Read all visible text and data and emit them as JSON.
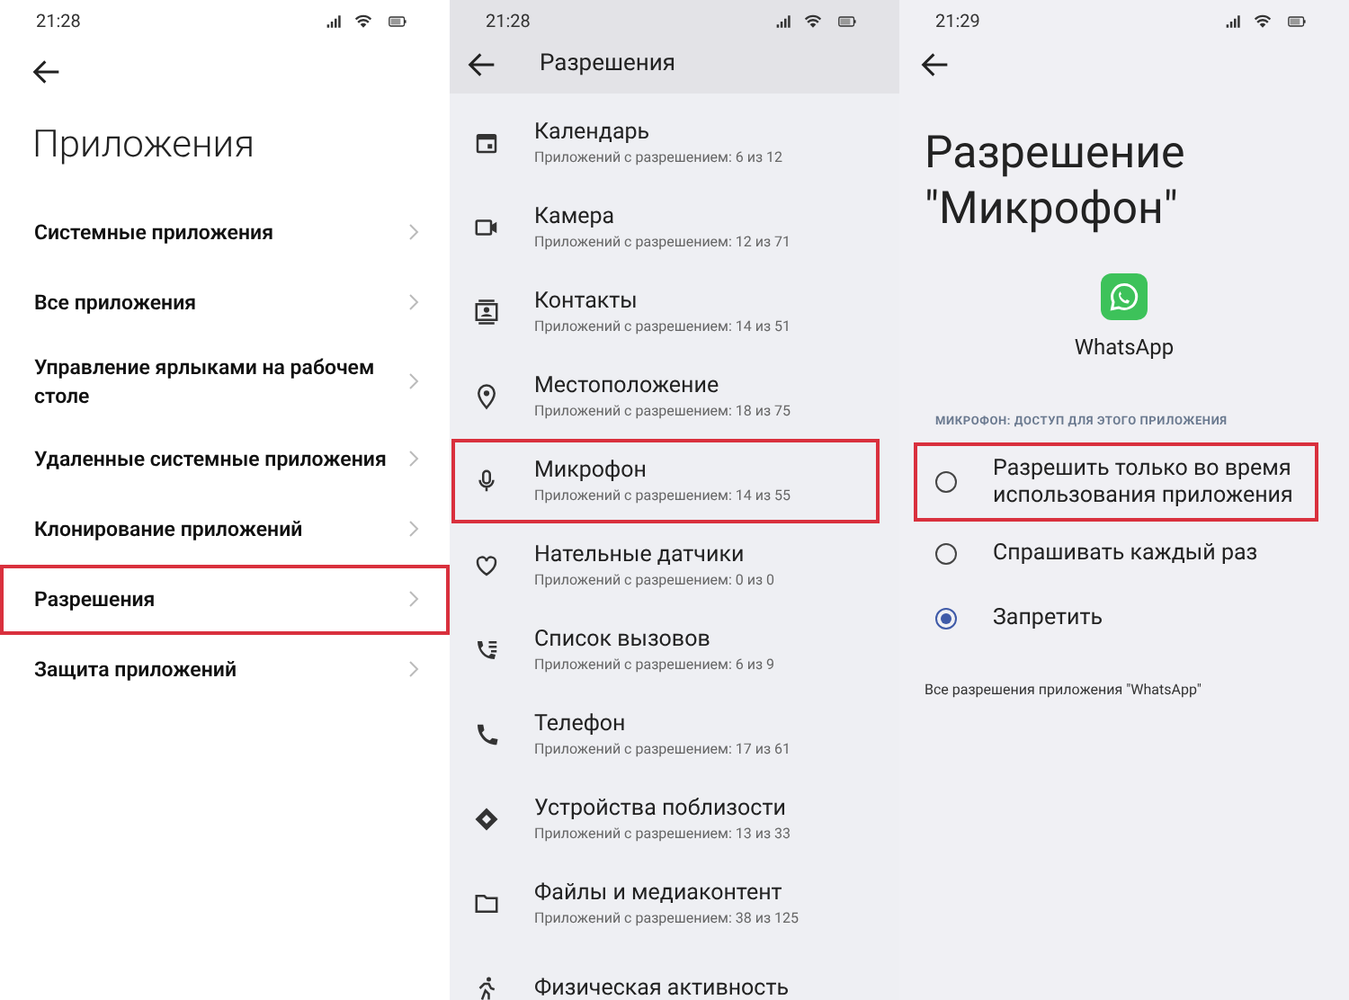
{
  "screens": [
    {
      "kind": "apps",
      "status_bar": {
        "time": "21:28"
      },
      "title": "Приложения",
      "items": [
        {
          "label": "Системные приложения",
          "highlighted": false
        },
        {
          "label": "Все приложения",
          "highlighted": false
        },
        {
          "label": "Управление ярлыками на рабочем столе",
          "highlighted": false
        },
        {
          "label": "Удаленные системные приложения",
          "highlighted": false
        },
        {
          "label": "Клонирование приложений",
          "highlighted": false
        },
        {
          "label": "Разрешения",
          "highlighted": true
        },
        {
          "label": "Защита приложений",
          "highlighted": false
        }
      ]
    },
    {
      "kind": "permissions",
      "status_bar": {
        "time": "21:28"
      },
      "title": "Разрешения",
      "items": [
        {
          "label": "Календарь",
          "subtitle": "Приложений с разрешением: 6 из 12",
          "highlighted": false
        },
        {
          "label": "Камера",
          "subtitle": "Приложений с разрешением: 12 из 71",
          "highlighted": false
        },
        {
          "label": "Контакты",
          "subtitle": "Приложений с разрешением: 14 из 51",
          "highlighted": false
        },
        {
          "label": "Местоположение",
          "subtitle": "Приложений с разрешением: 18 из 75",
          "highlighted": false
        },
        {
          "label": "Микрофон",
          "subtitle": "Приложений с разрешением: 14 из 55",
          "highlighted": true
        },
        {
          "label": "Нательные датчики",
          "subtitle": "Приложений с разрешением: 0 из 0",
          "highlighted": false
        },
        {
          "label": "Список вызовов",
          "subtitle": "Приложений с разрешением: 6 из 9",
          "highlighted": false
        },
        {
          "label": "Телефон",
          "subtitle": "Приложений с разрешением: 17 из 61",
          "highlighted": false
        },
        {
          "label": "Устройства поблизости",
          "subtitle": "Приложений с разрешением: 13 из 33",
          "highlighted": false
        },
        {
          "label": "Файлы и медиаконтент",
          "subtitle": "Приложений с разрешением: 38 из 125",
          "highlighted": false
        },
        {
          "label": "Физическая активность",
          "highlighted": false
        }
      ]
    },
    {
      "kind": "permission_detail",
      "status_bar": {
        "time": "21:29"
      },
      "title": "Разрешение \"Микрофон\"",
      "app": {
        "name": "WhatsApp"
      },
      "section_header": "МИКРОФОН: ДОСТУП ДЛЯ ЭТОГО ПРИЛОЖЕНИЯ",
      "options": [
        {
          "label": "Разрешить только во время использования приложения",
          "selected": false,
          "highlighted": true
        },
        {
          "label": "Спрашивать каждый раз",
          "selected": false,
          "highlighted": false
        },
        {
          "label": "Запретить",
          "selected": true,
          "highlighted": false
        }
      ],
      "footer_link": "Все разрешения приложения \"WhatsApp\""
    }
  ]
}
